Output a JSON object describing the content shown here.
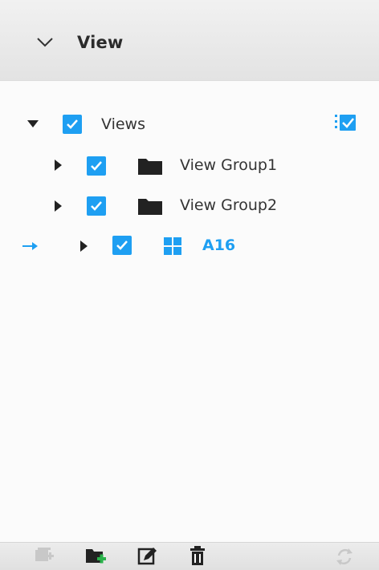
{
  "header": {
    "title": "View",
    "chevron_icon": "chevron-down-icon"
  },
  "tree": {
    "root": {
      "label": "Views",
      "checked": true,
      "expanded": true
    },
    "children": [
      {
        "label": "View Group1",
        "checked": true,
        "expanded": false,
        "icon": "folder-icon"
      },
      {
        "label": "View Group2",
        "checked": true,
        "expanded": false,
        "icon": "folder-icon"
      },
      {
        "label": "A16",
        "checked": true,
        "expanded": false,
        "icon": "grid-view-icon",
        "active": true
      }
    ]
  },
  "toolbar": {
    "buttons": [
      "add-view-button",
      "add-group-button",
      "edit-button",
      "delete-button",
      "refresh-button"
    ]
  },
  "colors": {
    "accent": "#1e9ff2",
    "header_bg": "#e8e8e8",
    "toolbar_bg": "#e4e4e4",
    "text": "#333333",
    "add_green": "#2ab24a"
  }
}
